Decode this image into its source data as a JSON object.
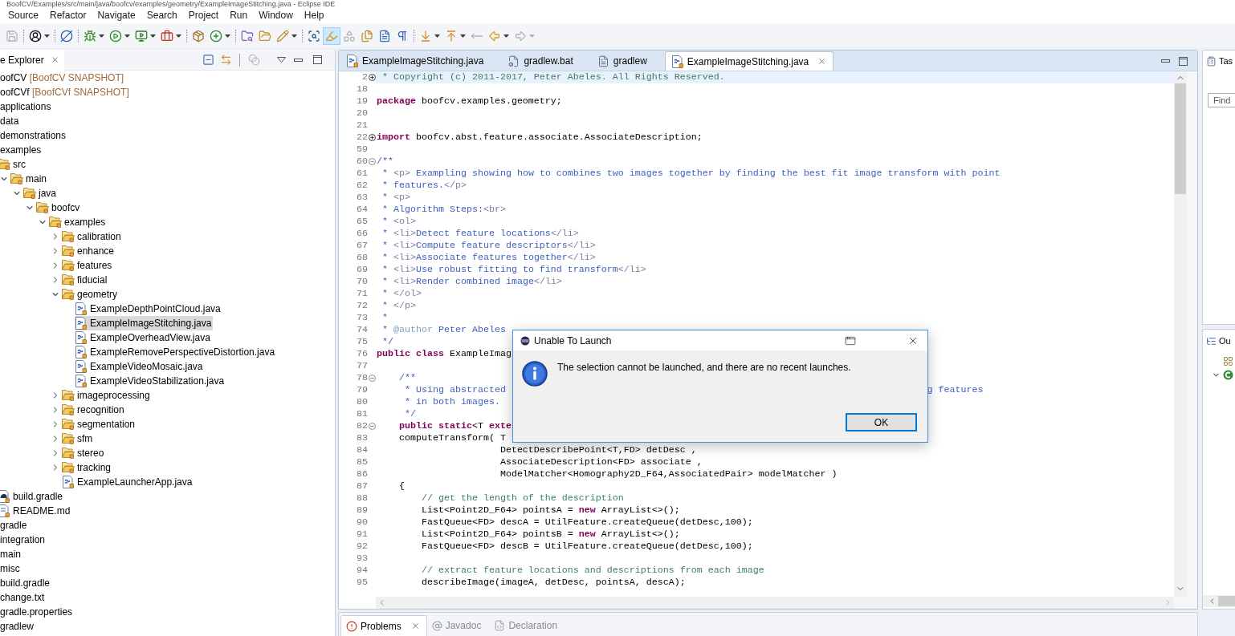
{
  "window": {
    "title": "BoofCV/Examples/src/main/java/boofcv/examples/geometry/ExampleImageStitching.java - Eclipse IDE"
  },
  "menu": [
    "Source",
    "Refactor",
    "Navigate",
    "Search",
    "Project",
    "Run",
    "Window",
    "Help"
  ],
  "toolbar_groups": [
    {
      "buttons": [
        {
          "kind": "save_all",
          "disabled": true,
          "pressed": false,
          "dropdown": false
        }
      ]
    },
    {
      "buttons": [
        {
          "kind": "user",
          "disabled": false,
          "pressed": false,
          "dropdown": true
        }
      ]
    },
    {
      "buttons": [
        {
          "kind": "skip_breakpoints",
          "disabled": false,
          "pressed": false,
          "dropdown": false
        }
      ]
    },
    {
      "buttons": [
        {
          "kind": "debug",
          "disabled": false,
          "pressed": false,
          "dropdown": true
        },
        {
          "kind": "run",
          "disabled": false,
          "pressed": false,
          "dropdown": true
        },
        {
          "kind": "coverage",
          "disabled": false,
          "pressed": false,
          "dropdown": true
        },
        {
          "kind": "external_tools",
          "disabled": false,
          "pressed": false,
          "dropdown": true
        }
      ]
    },
    {
      "buttons": [
        {
          "kind": "new_package",
          "disabled": false,
          "pressed": false,
          "dropdown": false
        },
        {
          "kind": "new_class",
          "disabled": false,
          "pressed": false,
          "dropdown": true
        }
      ]
    },
    {
      "buttons": [
        {
          "kind": "open_type",
          "disabled": false,
          "pressed": false,
          "dropdown": false
        },
        {
          "kind": "open_folder",
          "disabled": false,
          "pressed": false,
          "dropdown": false
        },
        {
          "kind": "search",
          "disabled": false,
          "pressed": false,
          "dropdown": true
        }
      ]
    },
    {
      "buttons": [
        {
          "kind": "breadcrumb",
          "disabled": false,
          "pressed": false,
          "dropdown": false
        },
        {
          "kind": "mark_occurrences",
          "disabled": false,
          "pressed": true,
          "dropdown": false
        },
        {
          "kind": "shapes",
          "disabled": true,
          "pressed": false,
          "dropdown": false
        },
        {
          "kind": "files",
          "disabled": false,
          "pressed": false,
          "dropdown": false
        },
        {
          "kind": "block",
          "disabled": false,
          "pressed": false,
          "dropdown": false
        },
        {
          "kind": "pilcrow",
          "disabled": false,
          "pressed": false,
          "dropdown": false
        }
      ]
    },
    {
      "buttons": [
        {
          "kind": "next_annotation",
          "disabled": false,
          "pressed": false,
          "dropdown": true
        },
        {
          "kind": "prev_annotation",
          "disabled": false,
          "pressed": false,
          "dropdown": true
        },
        {
          "kind": "last_edit",
          "disabled": true,
          "pressed": false,
          "dropdown": false
        },
        {
          "kind": "back",
          "disabled": false,
          "pressed": false,
          "dropdown": true
        },
        {
          "kind": "forward",
          "disabled": true,
          "pressed": false,
          "dropdown": true
        }
      ]
    }
  ],
  "explorer": {
    "tab": {
      "label": "e Explorer",
      "selected": true
    },
    "tool_groups": [
      {
        "buttons": [
          {
            "kind": "collapse_all",
            "disabled": false
          },
          {
            "kind": "link",
            "disabled": false
          }
        ]
      },
      {
        "buttons": [
          {
            "kind": "filters",
            "disabled": true
          }
        ]
      }
    ],
    "tree": [
      {
        "label": "oofCV",
        "decoration": "[BoofCV SNAPSHOT]",
        "selected": false
      },
      {
        "label": "oofCVf",
        "decoration": "[BoofCVf SNAPSHOT]",
        "selected": false
      },
      {
        "label": "applications",
        "selected": false
      },
      {
        "label": "data",
        "selected": false
      },
      {
        "label": "demonstrations",
        "selected": false
      },
      {
        "label": "examples",
        "selected": false,
        "children": [
          {
            "label": "src",
            "kind": "folder",
            "selected": false,
            "children": [
              {
                "label": "main",
                "kind": "folder",
                "expanded": true,
                "selected": false,
                "children": [
                  {
                    "label": "java",
                    "kind": "folder",
                    "expanded": true,
                    "selected": false,
                    "children": [
                      {
                        "label": "boofcv",
                        "kind": "folder",
                        "expanded": true,
                        "selected": false,
                        "children": [
                          {
                            "label": "examples",
                            "kind": "folder",
                            "expanded": true,
                            "selected": false,
                            "children": [
                              {
                                "label": "calibration",
                                "kind": "folder",
                                "expanded": false,
                                "selected": false
                              },
                              {
                                "label": "enhance",
                                "kind": "folder",
                                "expanded": false,
                                "selected": false
                              },
                              {
                                "label": "features",
                                "kind": "folder",
                                "expanded": false,
                                "selected": false
                              },
                              {
                                "label": "fiducial",
                                "kind": "folder",
                                "expanded": false,
                                "selected": false
                              },
                              {
                                "label": "geometry",
                                "kind": "folder",
                                "expanded": true,
                                "selected": false,
                                "children": [
                                  {
                                    "label": "ExampleDepthPointCloud.java",
                                    "kind": "java",
                                    "selected": false
                                  },
                                  {
                                    "label": "ExampleImageStitching.java",
                                    "kind": "java",
                                    "selected": true
                                  },
                                  {
                                    "label": "ExampleOverheadView.java",
                                    "kind": "java",
                                    "selected": false
                                  },
                                  {
                                    "label": "ExampleRemovePerspectiveDistortion.java",
                                    "kind": "java",
                                    "selected": false
                                  },
                                  {
                                    "label": "ExampleVideoMosaic.java",
                                    "kind": "java",
                                    "selected": false
                                  },
                                  {
                                    "label": "ExampleVideoStabilization.java",
                                    "kind": "java",
                                    "selected": false
                                  }
                                ]
                              },
                              {
                                "label": "imageprocessing",
                                "kind": "folder",
                                "expanded": false,
                                "selected": false
                              },
                              {
                                "label": "recognition",
                                "kind": "folder",
                                "expanded": false,
                                "selected": false
                              },
                              {
                                "label": "segmentation",
                                "kind": "folder",
                                "expanded": false,
                                "selected": false
                              },
                              {
                                "label": "sfm",
                                "kind": "folder",
                                "expanded": false,
                                "selected": false
                              },
                              {
                                "label": "stereo",
                                "kind": "folder",
                                "expanded": false,
                                "selected": false
                              },
                              {
                                "label": "tracking",
                                "kind": "folder",
                                "expanded": false,
                                "selected": false
                              },
                              {
                                "label": "ExampleLauncherApp.java",
                                "kind": "java",
                                "selected": false
                              }
                            ]
                          }
                        ]
                      }
                    ]
                  }
                ]
              }
            ]
          },
          {
            "label": "build.gradle",
            "kind": "gradle",
            "selected": false
          },
          {
            "label": "README.md",
            "kind": "markdown",
            "selected": false
          }
        ]
      },
      {
        "label": "gradle",
        "selected": false
      },
      {
        "label": "integration",
        "selected": false
      },
      {
        "label": "main",
        "selected": false
      },
      {
        "label": "misc",
        "selected": false
      },
      {
        "label": "build.gradle",
        "selected": false
      },
      {
        "label": "change.txt",
        "selected": false
      },
      {
        "label": "gradle.properties",
        "selected": false
      },
      {
        "label": "gradlew",
        "selected": false
      }
    ]
  },
  "editor": {
    "tabs": [
      {
        "label": "ExampleImageStitching.java",
        "kind": "java",
        "selected": false
      },
      {
        "label": "gradlew.bat",
        "kind": "batch",
        "selected": false
      },
      {
        "label": "gradlew",
        "kind": "text",
        "selected": false
      },
      {
        "label": "ExampleImageStitching.java",
        "kind": "java",
        "selected": true
      }
    ],
    "lines": [
      {
        "number": "2",
        "folded": true,
        "current": true,
        "segments": [
          {
            "kind": "comment",
            "text": " * Copyright (c) 2011-2017, Peter Abeles. All Rights Reserved."
          }
        ]
      },
      {
        "number": "18",
        "current": false
      },
      {
        "number": "19",
        "current": false,
        "segments": [
          {
            "kind": "keyword",
            "text": "package"
          },
          {
            "kind": "plain",
            "text": " boofcv.examples.geometry;"
          }
        ]
      },
      {
        "number": "20",
        "current": false
      },
      {
        "number": "21",
        "current": false
      },
      {
        "number": "22",
        "folded": true,
        "current": false,
        "segments": [
          {
            "kind": "keyword",
            "text": "import"
          },
          {
            "kind": "plain",
            "text": " boofcv.abst.feature.associate.AssociateDescription;"
          }
        ]
      },
      {
        "number": "59",
        "current": false
      },
      {
        "number": "60",
        "folded": false,
        "current": false,
        "segments": [
          {
            "kind": "doc",
            "text": "/**"
          }
        ]
      },
      {
        "number": "61",
        "current": false,
        "segments": [
          {
            "kind": "doc",
            "text": " * "
          },
          {
            "kind": "doc_tag",
            "text": "<p>"
          },
          {
            "kind": "doc",
            "text": " Exampling showing how to combines two images together by finding the best fit image transform with point"
          }
        ]
      },
      {
        "number": "62",
        "current": false,
        "segments": [
          {
            "kind": "doc",
            "text": " * features."
          },
          {
            "kind": "doc_tag",
            "text": "</p>"
          }
        ]
      },
      {
        "number": "63",
        "current": false,
        "segments": [
          {
            "kind": "doc",
            "text": " * "
          },
          {
            "kind": "doc_tag",
            "text": "<p>"
          }
        ]
      },
      {
        "number": "64",
        "current": false,
        "segments": [
          {
            "kind": "doc",
            "text": " * Algorithm Steps:"
          },
          {
            "kind": "doc_tag",
            "text": "<br>"
          }
        ]
      },
      {
        "number": "65",
        "current": false,
        "segments": [
          {
            "kind": "doc",
            "text": " * "
          },
          {
            "kind": "doc_tag",
            "text": "<ol>"
          }
        ]
      },
      {
        "number": "66",
        "current": false,
        "segments": [
          {
            "kind": "doc",
            "text": " * "
          },
          {
            "kind": "doc_tag",
            "text": "<li>"
          },
          {
            "kind": "doc",
            "text": "Detect feature locations"
          },
          {
            "kind": "doc_tag",
            "text": "</li>"
          }
        ]
      },
      {
        "number": "67",
        "current": false,
        "segments": [
          {
            "kind": "doc",
            "text": " * "
          },
          {
            "kind": "doc_tag",
            "text": "<li>"
          },
          {
            "kind": "doc",
            "text": "Compute feature descriptors"
          },
          {
            "kind": "doc_tag",
            "text": "</li>"
          }
        ]
      },
      {
        "number": "68",
        "current": false,
        "segments": [
          {
            "kind": "doc",
            "text": " * "
          },
          {
            "kind": "doc_tag",
            "text": "<li>"
          },
          {
            "kind": "doc",
            "text": "Associate features together"
          },
          {
            "kind": "doc_tag",
            "text": "</li>"
          }
        ]
      },
      {
        "number": "69",
        "current": false,
        "segments": [
          {
            "kind": "doc",
            "text": " * "
          },
          {
            "kind": "doc_tag",
            "text": "<li>"
          },
          {
            "kind": "doc",
            "text": "Use robust fitting to find transform"
          },
          {
            "kind": "doc_tag",
            "text": "</li>"
          }
        ]
      },
      {
        "number": "70",
        "current": false,
        "segments": [
          {
            "kind": "doc",
            "text": " * "
          },
          {
            "kind": "doc_tag",
            "text": "<li>"
          },
          {
            "kind": "doc",
            "text": "Render combined image"
          },
          {
            "kind": "doc_tag",
            "text": "</li>"
          }
        ]
      },
      {
        "number": "71",
        "current": false,
        "segments": [
          {
            "kind": "doc",
            "text": " * "
          },
          {
            "kind": "doc_tag",
            "text": "</ol>"
          }
        ]
      },
      {
        "number": "72",
        "current": false,
        "segments": [
          {
            "kind": "doc",
            "text": " * "
          },
          {
            "kind": "doc_tag",
            "text": "</p>"
          }
        ]
      },
      {
        "number": "73",
        "current": false,
        "segments": [
          {
            "kind": "doc",
            "text": " *"
          }
        ]
      },
      {
        "number": "74",
        "current": false,
        "segments": [
          {
            "kind": "doc",
            "text": " * "
          },
          {
            "kind": "doc_keyword",
            "text": "@author"
          },
          {
            "kind": "doc",
            "text": " Peter Abeles"
          }
        ]
      },
      {
        "number": "75",
        "current": false,
        "segments": [
          {
            "kind": "doc",
            "text": " */"
          }
        ]
      },
      {
        "number": "76",
        "current": false,
        "segments": [
          {
            "kind": "keyword",
            "text": "public class"
          },
          {
            "kind": "plain",
            "text": " ExampleImag"
          }
        ]
      },
      {
        "number": "77",
        "current": false
      },
      {
        "number": "78",
        "folded": false,
        "current": false,
        "segments": [
          {
            "kind": "doc",
            "text": "    /**"
          }
        ]
      },
      {
        "number": "79",
        "current": false,
        "segments": [
          {
            "kind": "doc",
            "text": "     * Using abstracted"
          }
        ],
        "tail": [
          {
            "kind": "doc",
            "text": "g features"
          }
        ]
      },
      {
        "number": "80",
        "current": false,
        "segments": [
          {
            "kind": "doc",
            "text": "     * in both images."
          }
        ]
      },
      {
        "number": "81",
        "current": false,
        "segments": [
          {
            "kind": "doc",
            "text": "     */"
          }
        ]
      },
      {
        "number": "82",
        "folded": false,
        "current": false,
        "segments": [
          {
            "kind": "keyword",
            "text": "    public static"
          },
          {
            "kind": "plain",
            "text": "<T "
          },
          {
            "kind": "keyword",
            "text": "exte"
          }
        ]
      },
      {
        "number": "83",
        "current": false,
        "segments": [
          {
            "kind": "plain",
            "text": "    computeTransform( T"
          }
        ]
      },
      {
        "number": "84",
        "current": false,
        "segments": [
          {
            "kind": "plain",
            "text": "                      DetectDescribePoint<T,FD> detDesc ,"
          }
        ]
      },
      {
        "number": "85",
        "current": false,
        "segments": [
          {
            "kind": "plain",
            "text": "                      AssociateDescription<FD> associate ,"
          }
        ]
      },
      {
        "number": "86",
        "current": false,
        "segments": [
          {
            "kind": "plain",
            "text": "                      ModelMatcher<Homography2D_F64,AssociatedPair> modelMatcher )"
          }
        ]
      },
      {
        "number": "87",
        "current": false,
        "segments": [
          {
            "kind": "plain",
            "text": "    {"
          }
        ]
      },
      {
        "number": "88",
        "current": false,
        "segments": [
          {
            "kind": "comment",
            "text": "        // get the length of the description"
          }
        ]
      },
      {
        "number": "89",
        "current": false,
        "segments": [
          {
            "kind": "plain",
            "text": "        List<Point2D_F64> pointsA = "
          },
          {
            "kind": "keyword",
            "text": "new"
          },
          {
            "kind": "plain",
            "text": " ArrayList<>();"
          }
        ]
      },
      {
        "number": "90",
        "current": false,
        "segments": [
          {
            "kind": "plain",
            "text": "        FastQueue<FD> descA = UtilFeature.createQueue(detDesc,100);"
          }
        ]
      },
      {
        "number": "91",
        "current": false,
        "segments": [
          {
            "kind": "plain",
            "text": "        List<Point2D_F64> pointsB = "
          },
          {
            "kind": "keyword",
            "text": "new"
          },
          {
            "kind": "plain",
            "text": " ArrayList<>();"
          }
        ]
      },
      {
        "number": "92",
        "current": false,
        "segments": [
          {
            "kind": "plain",
            "text": "        FastQueue<FD> descB = UtilFeature.createQueue(detDesc,100);"
          }
        ]
      },
      {
        "number": "93",
        "current": false
      },
      {
        "number": "94",
        "current": false,
        "segments": [
          {
            "kind": "comment",
            "text": "        // extract feature locations and descriptions from each image"
          }
        ]
      },
      {
        "number": "95",
        "current": false,
        "segments": [
          {
            "kind": "plain",
            "text": "        describeImage(imageA, detDesc, pointsA, descA);"
          }
        ]
      }
    ]
  },
  "dialog": {
    "title": "Unable To Launch",
    "message": "The selection cannot be launched, and there are no recent launches.",
    "buttons": [
      {
        "label": "OK",
        "default": true
      }
    ]
  },
  "bottom_panel": {
    "tabs": [
      {
        "label": "Problems",
        "kind": "problems",
        "selected": true
      },
      {
        "label": "Javadoc",
        "kind": "javadoc",
        "selected": false
      },
      {
        "label": "Declaration",
        "kind": "declaration",
        "selected": false
      }
    ]
  },
  "tasks_panel": {
    "tab_label": "Tas",
    "find_field": {
      "placeholder": "Find"
    }
  },
  "outline_panel": {
    "tab_label": "Ou",
    "items": [
      {
        "kind": "imports"
      },
      {
        "kind": "class",
        "expanded": true
      }
    ]
  }
}
